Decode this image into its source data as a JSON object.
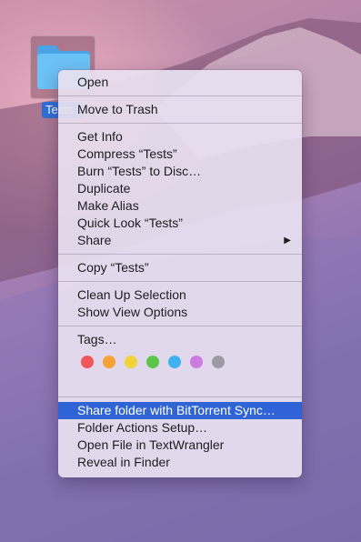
{
  "desktop": {
    "folder_label": "Tests"
  },
  "menu": {
    "groups": [
      [
        "Open"
      ],
      [
        "Move to Trash"
      ],
      [
        "Get Info",
        "Compress “Tests”",
        "Burn “Tests” to Disc…",
        "Duplicate",
        "Make Alias",
        "Quick Look “Tests”",
        "Share"
      ],
      [
        "Copy “Tests”"
      ],
      [
        "Clean Up Selection",
        "Show View Options"
      ],
      [
        "Tags…"
      ],
      [
        "Share folder with BitTorrent Sync…",
        "Folder Actions Setup…",
        "Open File in TextWrangler",
        "Reveal in Finder"
      ]
    ],
    "submenu_arrow": "▶",
    "highlighted_item": "Share folder with BitTorrent Sync…",
    "tag_colors": [
      {
        "name": "red",
        "color": "#f0565b"
      },
      {
        "name": "orange",
        "color": "#f5a136"
      },
      {
        "name": "yellow",
        "color": "#f2d43a"
      },
      {
        "name": "green",
        "color": "#5cc64b"
      },
      {
        "name": "blue",
        "color": "#3fb1ef"
      },
      {
        "name": "purple",
        "color": "#cc7be0"
      },
      {
        "name": "gray",
        "color": "#9e9aa3"
      }
    ]
  },
  "colors": {
    "highlight": "#2f63d6",
    "folder_blue": "#5fb6f0"
  }
}
